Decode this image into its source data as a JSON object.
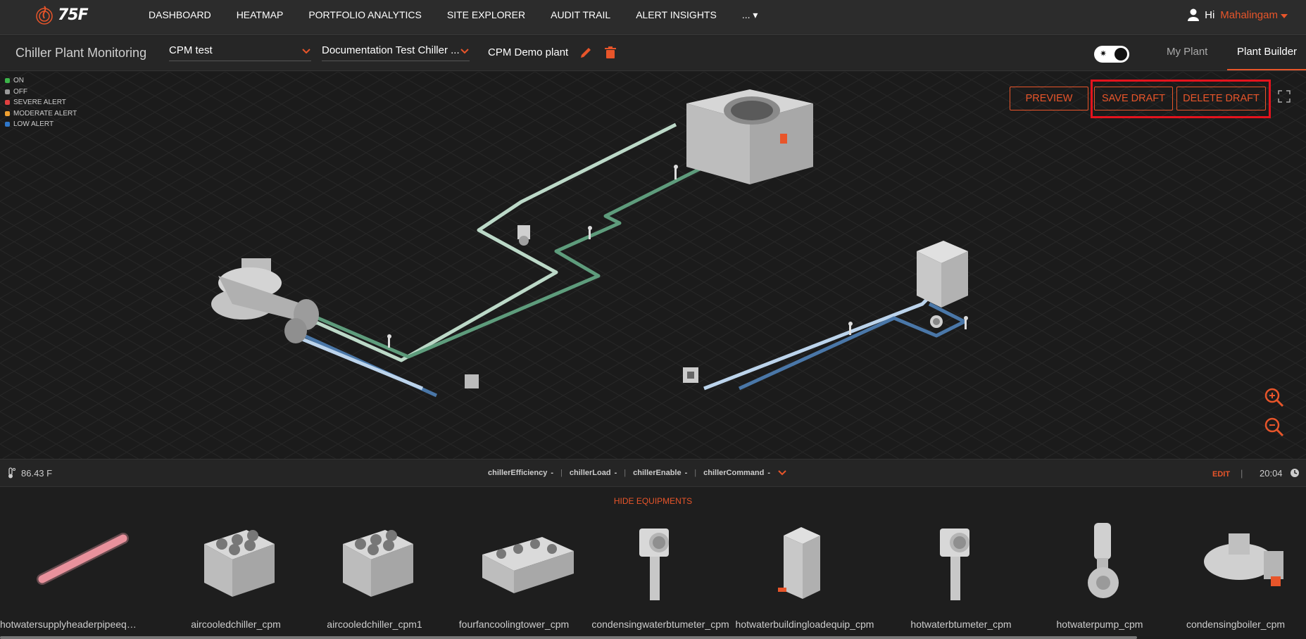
{
  "brand": {
    "logo_text": "75F",
    "accent": "#e8552a"
  },
  "nav": {
    "items": [
      "DASHBOARD",
      "HEATMAP",
      "PORTFOLIO ANALYTICS",
      "SITE EXPLORER",
      "AUDIT TRAIL",
      "ALERT INSIGHTS"
    ],
    "more": "..."
  },
  "user": {
    "greeting": "Hi",
    "name": "Mahalingam"
  },
  "subheader": {
    "title": "Chiller Plant Monitoring",
    "dropdown1": "CPM test",
    "dropdown2": "Documentation Test Chiller ...",
    "plant": "CPM Demo plant",
    "tabs": {
      "my_plant": "My Plant",
      "plant_builder": "Plant Builder"
    }
  },
  "legend": [
    {
      "label": "ON",
      "color": "#3cb54a"
    },
    {
      "label": "OFF",
      "color": "#9a9a9a"
    },
    {
      "label": "SEVERE ALERT",
      "color": "#e04040"
    },
    {
      "label": "MODERATE ALERT",
      "color": "#f0a030"
    },
    {
      "label": "LOW ALERT",
      "color": "#2f77c9"
    }
  ],
  "actions": {
    "preview": "PREVIEW",
    "save_draft": "SAVE DRAFT",
    "delete_draft": "DELETE DRAFT"
  },
  "infobar": {
    "temperature": "86.43 F",
    "params": [
      "chillerEfficiency",
      "chillerLoad",
      "chillerEnable",
      "chillerCommand"
    ],
    "param_value": "-",
    "edit": "EDIT",
    "time": "20:04"
  },
  "hide_equipments": "HIDE EQUIPMENTS",
  "equipment": [
    {
      "name": "hotwatersupplyheaderpipeequip_...",
      "icon": "pipe-icon"
    },
    {
      "name": "aircooledchiller_cpm",
      "icon": "chiller-icon"
    },
    {
      "name": "aircooledchiller_cpm1",
      "icon": "chiller-icon"
    },
    {
      "name": "fourfancoolingtower_cpm",
      "icon": "cooling-tower-icon"
    },
    {
      "name": "condensingwaterbtumeter_cpm",
      "icon": "btu-meter-icon"
    },
    {
      "name": "hotwaterbuildingloadequip_cpm",
      "icon": "building-icon"
    },
    {
      "name": "hotwaterbtumeter_cpm",
      "icon": "btu-meter-icon"
    },
    {
      "name": "hotwaterpump_cpm",
      "icon": "pump-icon"
    },
    {
      "name": "condensingboiler_cpm",
      "icon": "boiler-icon"
    }
  ]
}
